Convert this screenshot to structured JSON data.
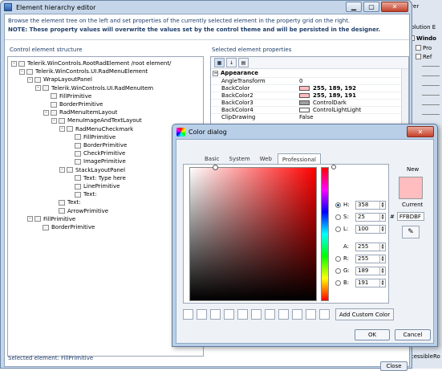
{
  "window": {
    "title": "Element hierarchy editor",
    "info_line1": "Browse the element tree on the left and set properties of the currently selected element in the property grid on the right.",
    "info_line2": "NOTE:  These property values will overwrite the values set by the control theme and will be persisted in the designer.",
    "tree_label": "Control element structure",
    "grid_label": "Selected element properties",
    "status": "Selected element: FillPrimitive",
    "close_label": "Close"
  },
  "tree": [
    {
      "label": "Telerik.WinControls.RootRadElement /root element/",
      "depth": 0,
      "expander": "-"
    },
    {
      "label": "Telerik.WinControls.UI.RadMenuElement",
      "depth": 1,
      "expander": "-"
    },
    {
      "label": "WrapLayoutPanel",
      "depth": 2,
      "expander": "-"
    },
    {
      "label": "Telerik.WinControls.UI.RadMenuItem",
      "depth": 3,
      "expander": "-"
    },
    {
      "label": "FillPrimitive",
      "depth": 4,
      "expander": ""
    },
    {
      "label": "BorderPrimitive",
      "depth": 4,
      "expander": ""
    },
    {
      "label": "RadMenuItemLayout",
      "depth": 4,
      "expander": "-"
    },
    {
      "label": "MenuImageAndTextLayout",
      "depth": 5,
      "expander": "-"
    },
    {
      "label": "RadMenuCheckmark",
      "depth": 6,
      "expander": "-"
    },
    {
      "label": "FillPrimitive",
      "depth": 7,
      "expander": ""
    },
    {
      "label": "BorderPrimitive",
      "depth": 7,
      "expander": ""
    },
    {
      "label": "CheckPrimitive",
      "depth": 7,
      "expander": ""
    },
    {
      "label": "ImagePrimitive",
      "depth": 7,
      "expander": ""
    },
    {
      "label": "StackLayoutPanel",
      "depth": 6,
      "expander": "-"
    },
    {
      "label": "Text: Type here",
      "depth": 7,
      "expander": ""
    },
    {
      "label": "LinePrimitive",
      "depth": 7,
      "expander": ""
    },
    {
      "label": "Text:",
      "depth": 7,
      "expander": ""
    },
    {
      "label": "Text:",
      "depth": 5,
      "expander": ""
    },
    {
      "label": "ArrowPrimitive",
      "depth": 5,
      "expander": ""
    },
    {
      "label": "FillPrimitive",
      "depth": 2,
      "expander": "-"
    },
    {
      "label": "BorderPrimitive",
      "depth": 3,
      "expander": ""
    }
  ],
  "property_grid": {
    "category": "Appearance",
    "rows": [
      {
        "name": "AngleTransform",
        "value": "0",
        "swatch": null,
        "bold": false
      },
      {
        "name": "BackColor",
        "value": "255, 189, 192",
        "swatch": "#ffbdc0",
        "bold": true
      },
      {
        "name": "BackColor2",
        "value": "255, 189, 191",
        "swatch": "#ffbdbf",
        "bold": true
      },
      {
        "name": "BackColor3",
        "value": "ControlDark",
        "swatch": "#a0a0a0",
        "bold": false
      },
      {
        "name": "BackColor4",
        "value": "ControlLightLight",
        "swatch": "#ffffff",
        "bold": false
      },
      {
        "name": "ClipDrawing",
        "value": "False",
        "swatch": null,
        "bold": false
      }
    ]
  },
  "color_dialog": {
    "title": "Color dialog",
    "tabs": [
      "Basic",
      "System",
      "Web",
      "Professional"
    ],
    "active_tab": "Professional",
    "fields": [
      {
        "label": "H:",
        "value": "358",
        "radio": true,
        "checked": true
      },
      {
        "label": "S:",
        "value": "25",
        "radio": true,
        "checked": false
      },
      {
        "label": "L:",
        "value": "100",
        "radio": true,
        "checked": false
      },
      {
        "label": "A:",
        "value": "255",
        "radio": false,
        "checked": false
      },
      {
        "label": "R:",
        "value": "255",
        "radio": true,
        "checked": false
      },
      {
        "label": "G:",
        "value": "189",
        "radio": true,
        "checked": false
      },
      {
        "label": "B:",
        "value": "191",
        "radio": true,
        "checked": false
      }
    ],
    "new_label": "New",
    "current_label": "Current",
    "hex_prefix": "#",
    "hex_value": "FFBDBF",
    "new_color": "#ffbdbf",
    "add_custom_label": "Add Custom Color",
    "ok_label": "OK",
    "cancel_label": "Cancel"
  },
  "vs_panel": {
    "tab1": "Solution E",
    "item1": "Windo",
    "item2": "Pro",
    "item3": "Ref",
    "bottom_text": "ccessibleRo"
  }
}
